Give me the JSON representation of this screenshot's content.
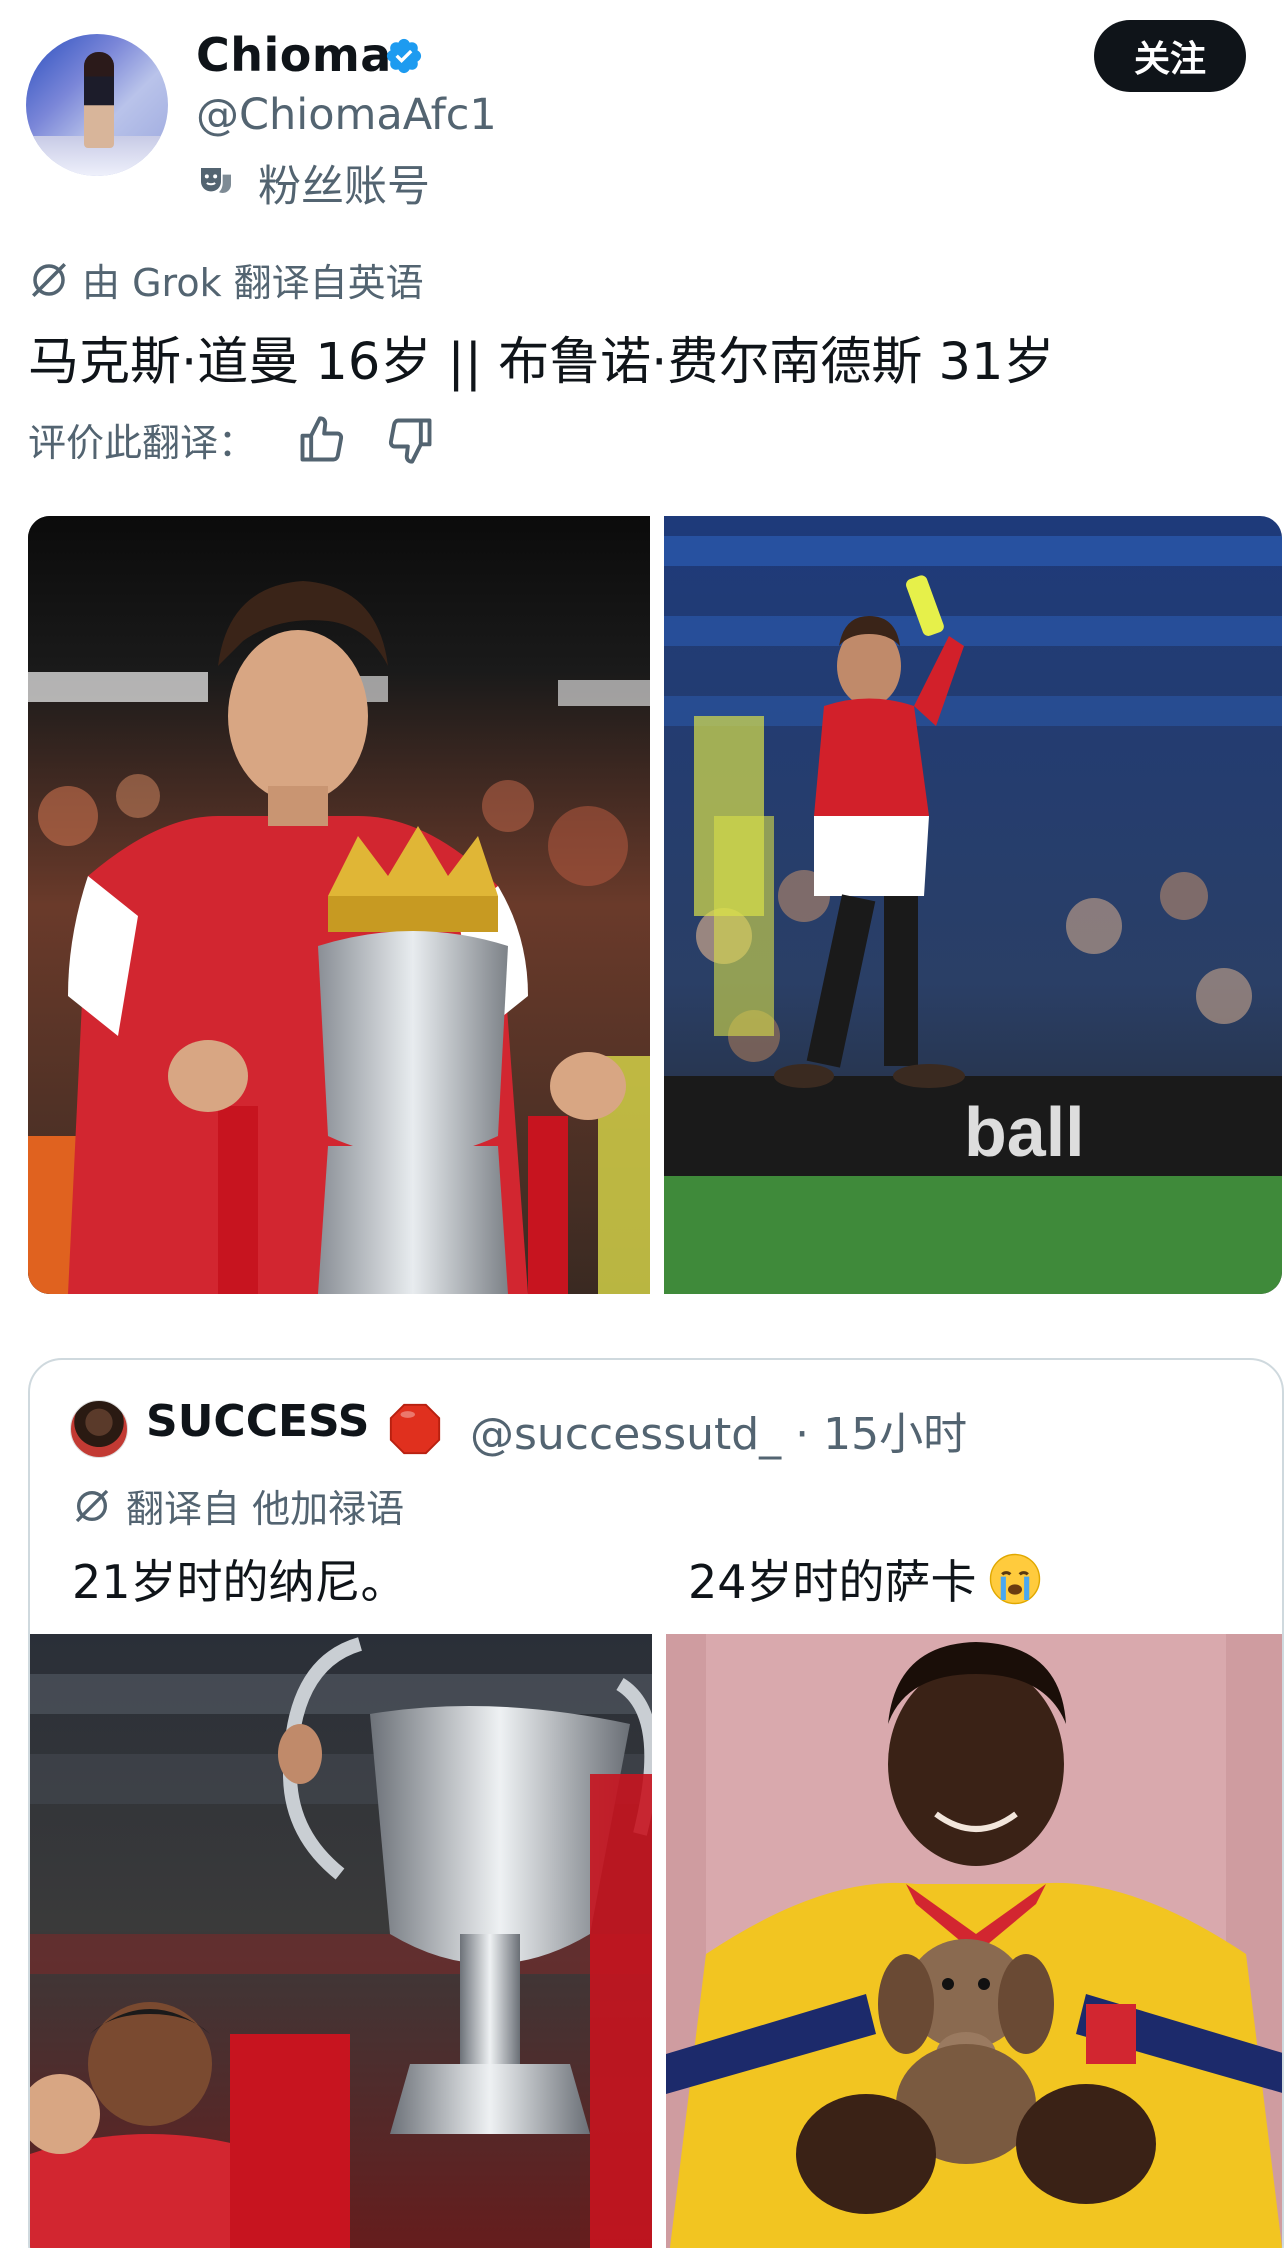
{
  "author": {
    "display_name": "Chioma",
    "handle": "@ChiomaAfc1",
    "account_label": "粉丝账号",
    "follow_label": "关注"
  },
  "translation": {
    "label": "由 Grok 翻译自英语",
    "text": "马克斯·道曼 16岁 || 布鲁诺·费尔南德斯 31岁",
    "rate_label": "评价此翻译："
  },
  "images": [
    {
      "alt": "young player holding trophy"
    },
    {
      "alt": "player in red applauding"
    }
  ],
  "quote": {
    "name": "SUCCESS",
    "handle_time": "@successutd_ · 15小时",
    "translation_label": "翻译自 他加禄语",
    "text_left": "21岁时的纳尼。",
    "text_right": "24岁时的萨卡"
  },
  "colors": {
    "text_primary": "#0f1419",
    "text_secondary": "#536471",
    "verified_blue": "#1d9bf0",
    "border": "#cfd9de",
    "follow_bg": "#0f1419"
  }
}
